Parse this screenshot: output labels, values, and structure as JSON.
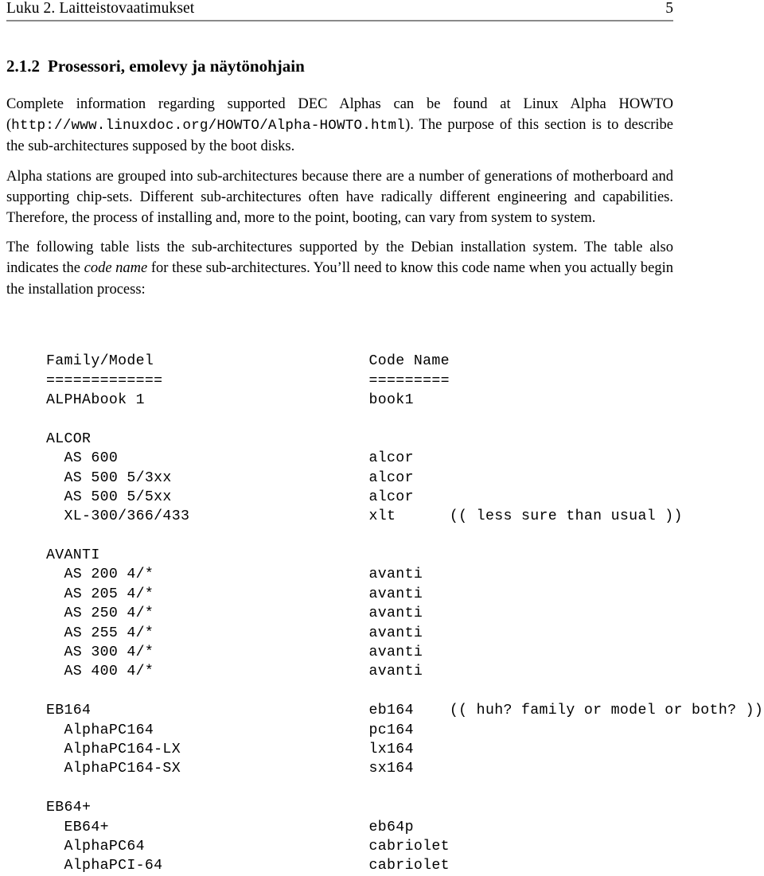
{
  "header": {
    "title": "Luku 2. Laitteistovaatimukset",
    "page_number": "5",
    "rule_color": "#8a8a8a"
  },
  "section": {
    "number": "2.1.2",
    "title": "Prosessori, emolevy ja näytönohjain"
  },
  "paragraphs": {
    "p1": {
      "before_url": "Complete information regarding supported DEC Alphas can be found at Linux Alpha HOWTO (",
      "url": "http://www.linuxdoc.org/HOWTO/Alpha-HOWTO.html",
      "after_url": "). The purpose of this section is to describe the sub-architectures supposed by the boot disks."
    },
    "p2": "Alpha stations are grouped into sub-architectures because there are a number of generations of motherboard and supporting chip-sets. Different sub-architectures often have radically different engineering and capabilities. Therefore, the process of installing and, more to the point, booting, can vary from system to system.",
    "p3": {
      "part1": "The following table lists the sub-architectures supported by the Debian installation system. The table also indicates the ",
      "emphasis": "code name",
      "part2": " for these sub-architectures. You’ll need to know this code name when you actually begin the installation process:"
    }
  },
  "table": {
    "columns": [
      "Family/Model",
      "Code Name"
    ],
    "separators": [
      "=============",
      "========="
    ],
    "col1_width": 36,
    "rows": [
      {
        "kind": "entry",
        "indent": 0,
        "family": "ALPHAbook 1",
        "code": "book1",
        "note": ""
      },
      {
        "kind": "blank",
        "indent": 0,
        "family": "",
        "code": "",
        "note": ""
      },
      {
        "kind": "group",
        "indent": 0,
        "family": "ALCOR",
        "code": "",
        "note": ""
      },
      {
        "kind": "entry",
        "indent": 2,
        "family": "AS 600",
        "code": "alcor",
        "note": ""
      },
      {
        "kind": "entry",
        "indent": 2,
        "family": "AS 500 5/3xx",
        "code": "alcor",
        "note": ""
      },
      {
        "kind": "entry",
        "indent": 2,
        "family": "AS 500 5/5xx",
        "code": "alcor",
        "note": ""
      },
      {
        "kind": "entry",
        "indent": 2,
        "family": "XL-300/366/433",
        "code": "xlt",
        "note": "(( less sure than usual ))"
      },
      {
        "kind": "blank",
        "indent": 0,
        "family": "",
        "code": "",
        "note": ""
      },
      {
        "kind": "group",
        "indent": 0,
        "family": "AVANTI",
        "code": "",
        "note": ""
      },
      {
        "kind": "entry",
        "indent": 2,
        "family": "AS 200 4/*",
        "code": "avanti",
        "note": ""
      },
      {
        "kind": "entry",
        "indent": 2,
        "family": "AS 205 4/*",
        "code": "avanti",
        "note": ""
      },
      {
        "kind": "entry",
        "indent": 2,
        "family": "AS 250 4/*",
        "code": "avanti",
        "note": ""
      },
      {
        "kind": "entry",
        "indent": 2,
        "family": "AS 255 4/*",
        "code": "avanti",
        "note": ""
      },
      {
        "kind": "entry",
        "indent": 2,
        "family": "AS 300 4/*",
        "code": "avanti",
        "note": ""
      },
      {
        "kind": "entry",
        "indent": 2,
        "family": "AS 400 4/*",
        "code": "avanti",
        "note": ""
      },
      {
        "kind": "blank",
        "indent": 0,
        "family": "",
        "code": "",
        "note": ""
      },
      {
        "kind": "entry",
        "indent": 0,
        "family": "EB164",
        "code": "eb164",
        "note": "(( huh? family or model or both? ))"
      },
      {
        "kind": "entry",
        "indent": 2,
        "family": "AlphaPC164",
        "code": "pc164",
        "note": ""
      },
      {
        "kind": "entry",
        "indent": 2,
        "family": "AlphaPC164-LX",
        "code": "lx164",
        "note": ""
      },
      {
        "kind": "entry",
        "indent": 2,
        "family": "AlphaPC164-SX",
        "code": "sx164",
        "note": ""
      },
      {
        "kind": "blank",
        "indent": 0,
        "family": "",
        "code": "",
        "note": ""
      },
      {
        "kind": "group",
        "indent": 0,
        "family": "EB64+",
        "code": "",
        "note": ""
      },
      {
        "kind": "entry",
        "indent": 2,
        "family": "EB64+",
        "code": "eb64p",
        "note": ""
      },
      {
        "kind": "entry",
        "indent": 2,
        "family": "AlphaPC64",
        "code": "cabriolet",
        "note": ""
      },
      {
        "kind": "entry",
        "indent": 2,
        "family": "AlphaPCI-64",
        "code": "cabriolet",
        "note": ""
      }
    ]
  }
}
